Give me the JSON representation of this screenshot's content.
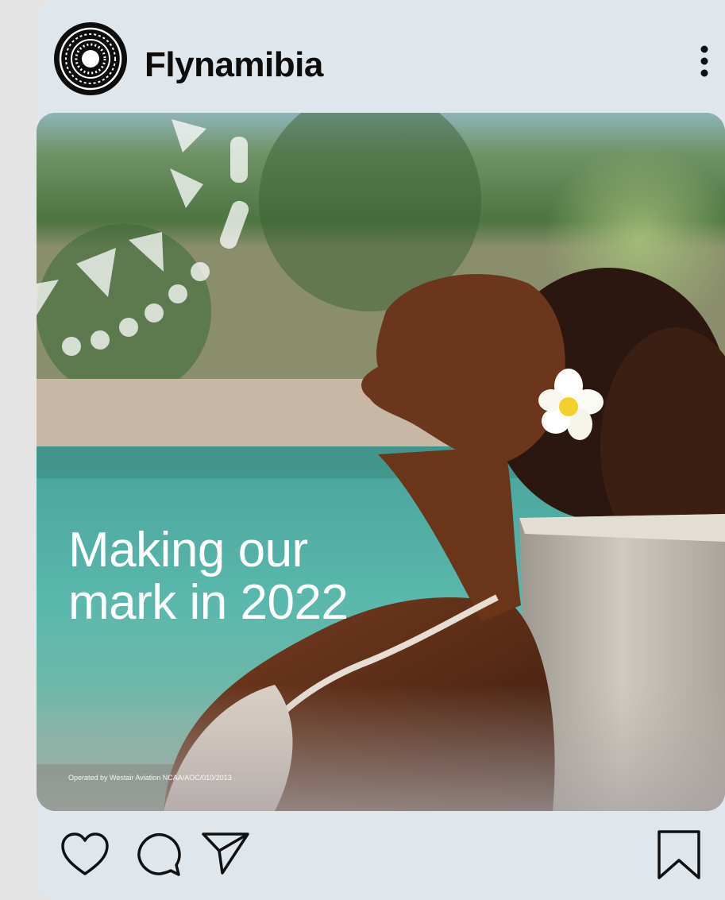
{
  "post": {
    "account_name": "Flynamibia",
    "headline_line1": "Making our",
    "headline_line2": "mark in 2022",
    "fineprint": "Operated by Westair Aviation NCAA/AOC/010/2013"
  },
  "icons": {
    "avatar": "flynamibia-sun-logo",
    "more": "more-vertical-icon",
    "like": "heart-icon",
    "comment": "comment-bubble-icon",
    "share": "paper-plane-icon",
    "save": "bookmark-icon"
  },
  "colors": {
    "card_background": "#dfe6ec",
    "text": "#0c0c0c",
    "headline": "#ffffff"
  }
}
